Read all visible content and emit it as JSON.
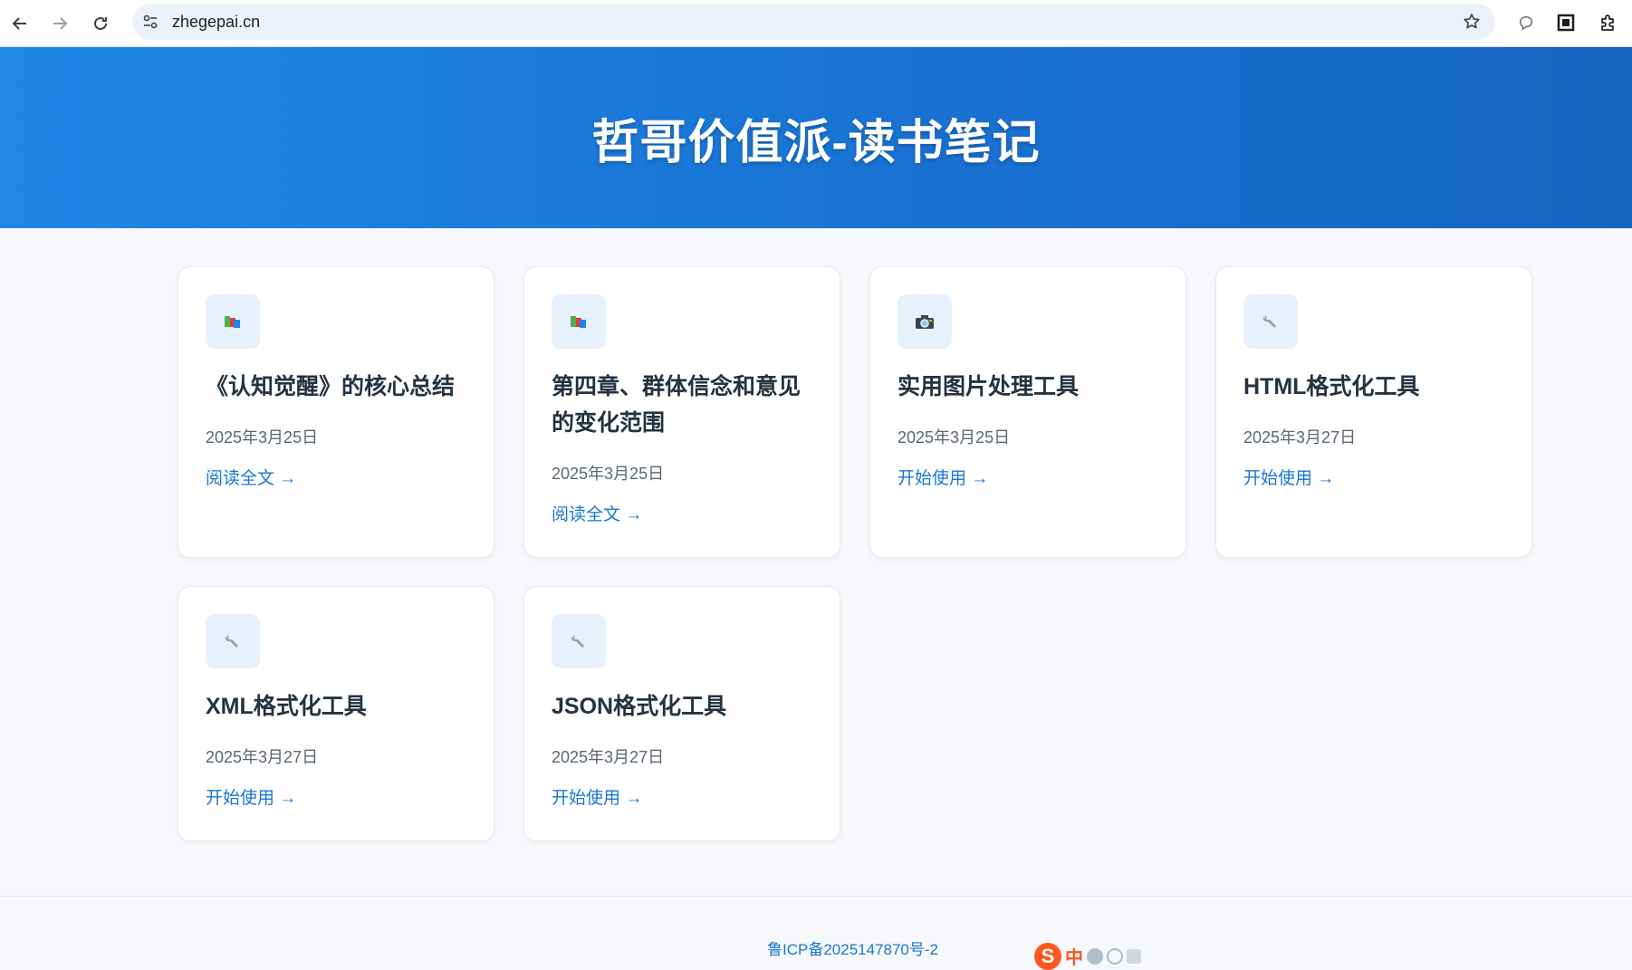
{
  "browser": {
    "url": "zhegepai.cn"
  },
  "hero": {
    "title": "哲哥价值派-读书笔记"
  },
  "cards": [
    {
      "icon": "books-icon",
      "title": "《认知觉醒》的核心总结",
      "date": "2025年3月25日",
      "link": "阅读全文 →"
    },
    {
      "icon": "books-icon",
      "title": "第四章、群体信念和意见的变化范围",
      "date": "2025年3月25日",
      "link": "阅读全文 →"
    },
    {
      "icon": "camera-icon",
      "title": "实用图片处理工具",
      "date": "2025年3月25日",
      "link": "开始使用 →"
    },
    {
      "icon": "wrench-icon",
      "title": "HTML格式化工具",
      "date": "2025年3月27日",
      "link": "开始使用 →"
    },
    {
      "icon": "wrench-icon",
      "title": "XML格式化工具",
      "date": "2025年3月27日",
      "link": "开始使用 →"
    },
    {
      "icon": "wrench-icon",
      "title": "JSON格式化工具",
      "date": "2025年3月27日",
      "link": "开始使用 →"
    }
  ],
  "footer": {
    "icp": "鲁ICP备2025147870号-2",
    "ime_label": "中"
  },
  "colors": {
    "accent": "#1976d2",
    "hero_start": "#1e88e5",
    "hero_end": "#1565c0"
  }
}
